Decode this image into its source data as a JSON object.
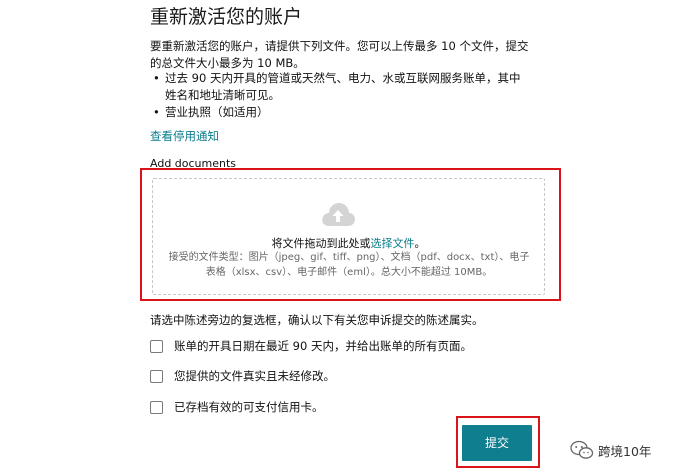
{
  "page": {
    "title": "重新激活您的账户",
    "intro": "要重新激活您的账户，请提供下列文件。您可以上传最多 10 个文件，提交的总文件大小最多为 10 MB。",
    "bullets": [
      "过去 90 天内开具的管道或天然气、电力、水或互联网服务账单，其中姓名和地址清晰可见。",
      "营业执照（如适用）"
    ],
    "view_notice_link": "查看停用通知",
    "add_documents_label": "Add documents"
  },
  "dropzone": {
    "upload_icon": "cloud-upload-icon",
    "drag_text": "将文件拖动到此处或",
    "select_link": "选择文件",
    "drag_suffix": "。",
    "accepted_types": "接受的文件类型：图片（jpeg、gif、tiff、png）、文档（pdf、docx、txt）、电子表格（xlsx、csv）、电子邮件（eml）。总大小不能超过 10MB。"
  },
  "confirmation": {
    "prompt": "请选中陈述旁边的复选框，确认以下有关您申诉提交的陈述属实。",
    "checkboxes": [
      {
        "label": "账单的开具日期在最近 90 天内，并给出账单的所有页面。",
        "checked": false
      },
      {
        "label": "您提供的文件真实且未经修改。",
        "checked": false
      },
      {
        "label": "已存档有效的可支付信用卡。",
        "checked": false
      }
    ]
  },
  "submit_label": "提交",
  "watermark": {
    "text": "跨境10年",
    "icon": "wechat-icon"
  },
  "colors": {
    "accent": "#0f7e8f",
    "link": "#0a7d8c",
    "highlight": "#d9141b"
  }
}
